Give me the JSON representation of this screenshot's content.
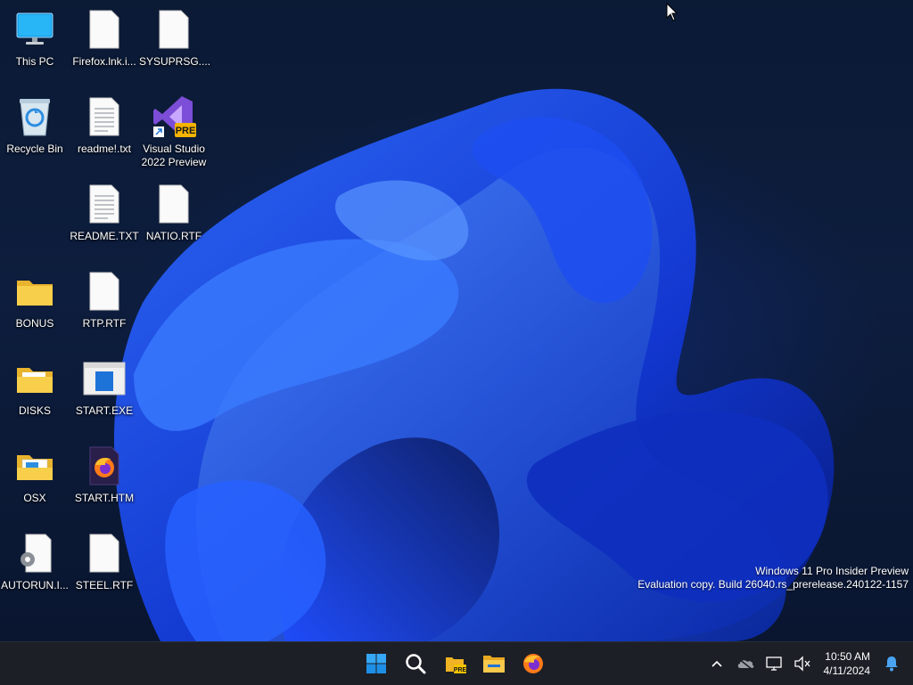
{
  "desktop": {
    "icons": [
      {
        "label": "This PC",
        "icon": "this-pc-icon"
      },
      {
        "label": "Recycle Bin",
        "icon": "recycle-bin-icon"
      },
      {
        "label": "BONUS",
        "icon": "folder-icon"
      },
      {
        "label": "DISKS",
        "icon": "folder-icon"
      },
      {
        "label": "OSX",
        "icon": "folder-icon"
      },
      {
        "label": "AUTORUN.I...",
        "icon": "settings-file-icon"
      },
      {
        "label": "Firefox.lnk.i...",
        "icon": "blank-file-icon"
      },
      {
        "label": "readme!.txt",
        "icon": "text-file-icon"
      },
      {
        "label": "README.TXT",
        "icon": "text-file-icon"
      },
      {
        "label": "RTP.RTF",
        "icon": "blank-file-icon"
      },
      {
        "label": "START.EXE",
        "icon": "exe-window-icon"
      },
      {
        "label": "START.HTM",
        "icon": "firefox-html-icon"
      },
      {
        "label": "STEEL.RTF",
        "icon": "blank-file-icon"
      },
      {
        "label": "SYSUPRSG....",
        "icon": "blank-file-icon"
      },
      {
        "label": "Visual Studio\n2022 Preview",
        "icon": "visual-studio-icon"
      },
      {
        "label": "NATIO.RTF",
        "icon": "blank-file-icon"
      }
    ],
    "vs_badge": "PRE"
  },
  "watermark": {
    "line1": "Windows 11 Pro Insider Preview",
    "line2": "Evaluation copy. Build 26040.rs_prerelease.240122-1157"
  },
  "taskbar": {
    "pinned": [
      "start-icon",
      "search-icon",
      "file-explorer-preview-icon",
      "file-explorer-icon",
      "firefox-icon"
    ],
    "tray": [
      "chevron-up-icon",
      "onedrive-icon",
      "network-icon",
      "volume-muted-icon"
    ],
    "clock": {
      "time": "10:50 AM",
      "date": "4/11/2024"
    },
    "notification": "bell-icon"
  },
  "colors": {
    "taskbar_bg": "#1c1f26",
    "accent": "#0078d4",
    "folder": "#f5c842"
  }
}
